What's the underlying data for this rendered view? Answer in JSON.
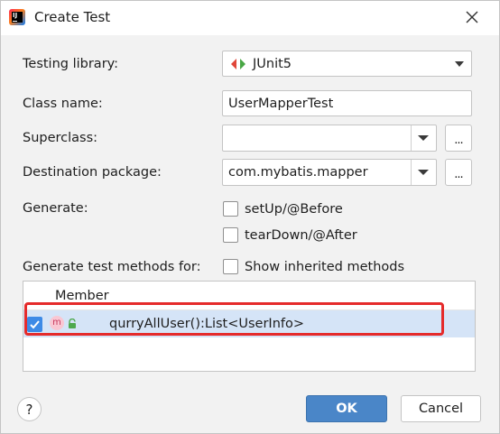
{
  "window": {
    "title": "Create Test",
    "app_icon": "intellij-idea-icon",
    "close_icon": "close-icon"
  },
  "form": {
    "testing_library": {
      "label": "Testing library:",
      "value": "JUnit5",
      "icon": "junit5-icon"
    },
    "class_name": {
      "label": "Class name:",
      "value": "UserMapperTest"
    },
    "superclass": {
      "label": "Superclass:",
      "value": "",
      "browse_label": "..."
    },
    "destination_package": {
      "label": "Destination package:",
      "value": "com.mybatis.mapper",
      "browse_label": "..."
    },
    "generate": {
      "label": "Generate:",
      "options": [
        {
          "label": "setUp/@Before",
          "checked": false
        },
        {
          "label": "tearDown/@After",
          "checked": false
        }
      ]
    },
    "test_methods": {
      "label": "Generate test methods for:",
      "show_inherited": {
        "label": "Show inherited methods",
        "checked": false
      }
    }
  },
  "members_table": {
    "column_header": "Member",
    "rows": [
      {
        "checked": true,
        "method_icon_letter": "m",
        "visibility_icon": "public-lock-icon",
        "signature": "qurryAllUser():List<UserInfo>",
        "selected": true
      }
    ]
  },
  "footer": {
    "help_label": "?",
    "ok_label": "OK",
    "cancel_label": "Cancel"
  },
  "colors": {
    "accent_blue": "#4a86c8",
    "checkbox_checked": "#3d8ae6",
    "row_selected": "#d5e4f7",
    "annotation_red": "#e52b2b",
    "method_icon_bg": "#f9c7d3",
    "lock_green": "#4ea94e"
  }
}
